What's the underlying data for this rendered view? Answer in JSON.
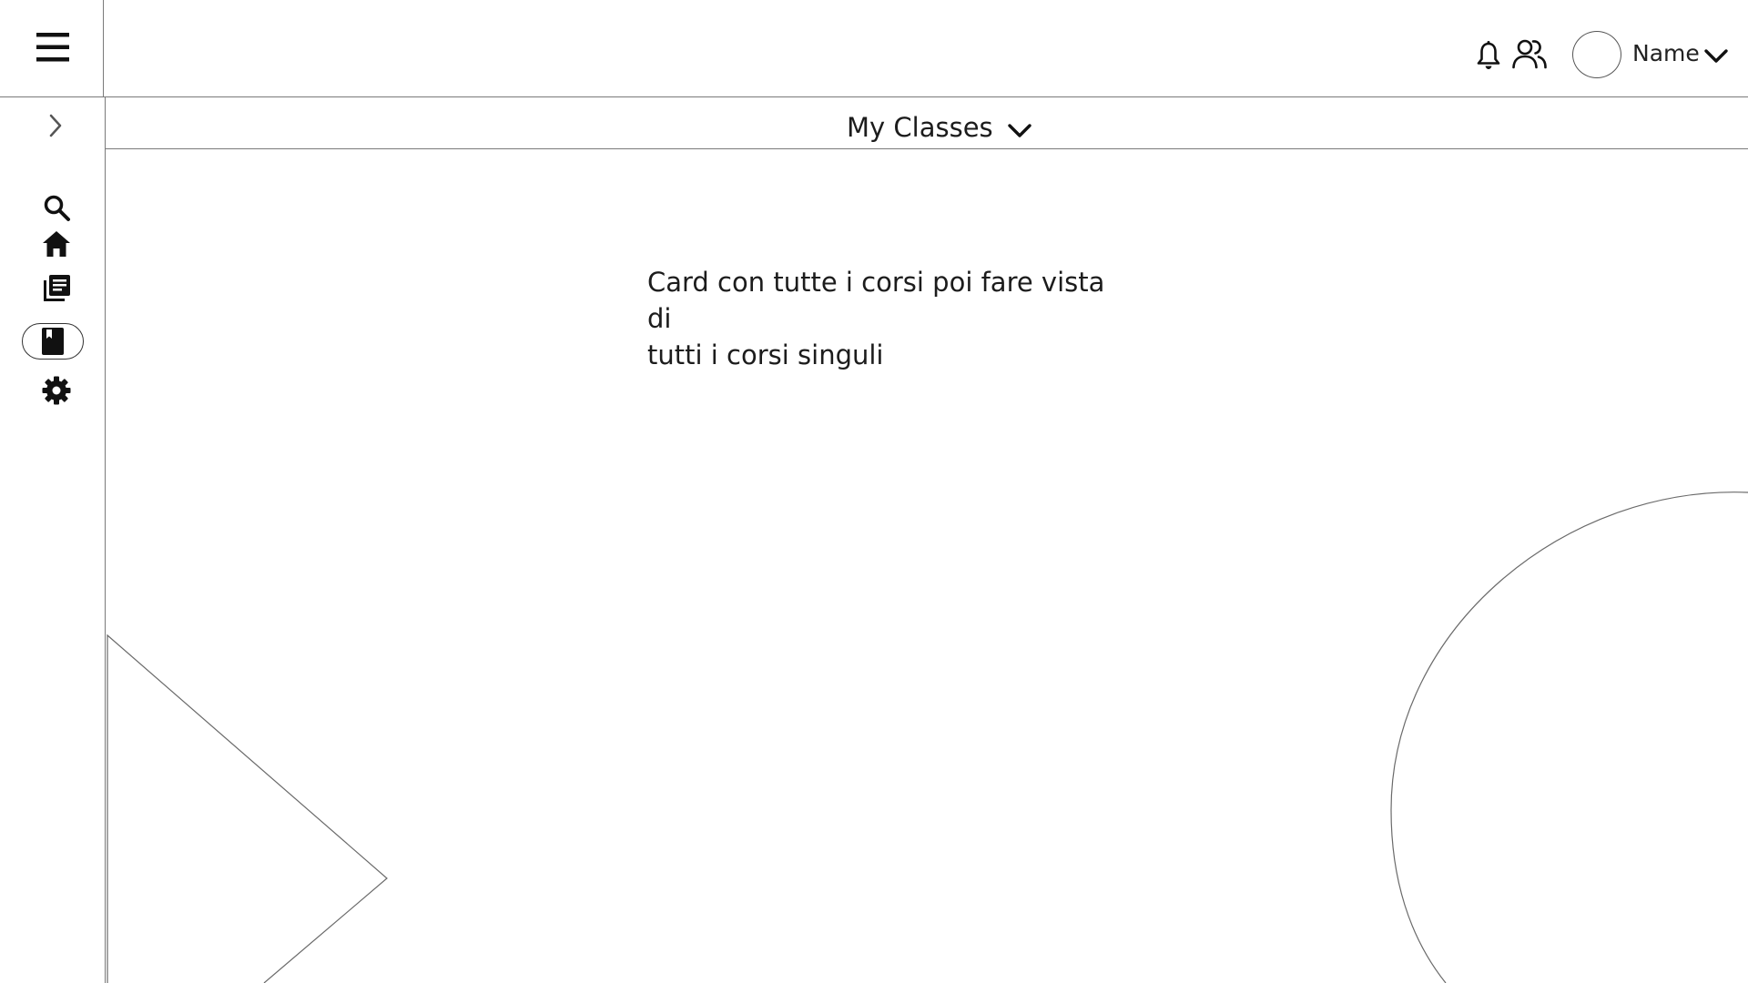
{
  "header": {
    "menu_icon": "hamburger-menu-icon",
    "notifications_icon": "bell-icon",
    "people_icon": "people-icon",
    "avatar_icon": "avatar-circle",
    "user_name": "Name",
    "user_menu_icon": "chevron-down-icon"
  },
  "sidebar": {
    "expand_icon": "chevron-right-icon",
    "items": [
      {
        "name": "search",
        "icon": "search-icon",
        "active": false
      },
      {
        "name": "home",
        "icon": "home-icon",
        "active": false
      },
      {
        "name": "library",
        "icon": "library-books-icon",
        "active": false
      },
      {
        "name": "my-classes",
        "icon": "book-icon",
        "active": true
      },
      {
        "name": "settings",
        "icon": "gear-icon",
        "active": false
      }
    ]
  },
  "main": {
    "title": "My Classes",
    "title_dropdown_icon": "chevron-down-icon",
    "note_line_1": "Card con tutte i corsi poi fare vista di",
    "note_line_2": "tutti i corsi singuli"
  },
  "colors": {
    "background": "#ffffff",
    "text": "#1c1c1c",
    "line": "#7a7a7a",
    "icon": "#111111"
  }
}
